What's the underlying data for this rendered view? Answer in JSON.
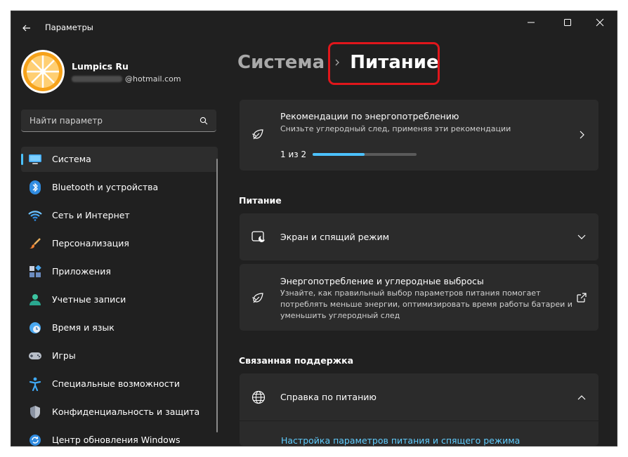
{
  "titlebar": {
    "app_title": "Параметры",
    "back_icon": "back-arrow-icon",
    "minimize_icon": "minimize-icon",
    "maximize_icon": "maximize-icon",
    "close_icon": "close-icon"
  },
  "profile": {
    "name": "Lumpics Ru",
    "email_visible_part": "@hotmail.com",
    "avatar_icon": "orange-slice-avatar"
  },
  "search": {
    "placeholder": "Найти параметр",
    "icon": "search-icon"
  },
  "sidebar": {
    "active_index": 0,
    "items": [
      {
        "label": "Система",
        "icon": "monitor-icon"
      },
      {
        "label": "Bluetooth и устройства",
        "icon": "bluetooth-icon"
      },
      {
        "label": "Сеть и Интернет",
        "icon": "wifi-icon"
      },
      {
        "label": "Персонализация",
        "icon": "brush-icon"
      },
      {
        "label": "Приложения",
        "icon": "apps-icon"
      },
      {
        "label": "Учетные записи",
        "icon": "person-icon"
      },
      {
        "label": "Время и язык",
        "icon": "clock-globe-icon"
      },
      {
        "label": "Игры",
        "icon": "gamepad-icon"
      },
      {
        "label": "Специальные возможности",
        "icon": "accessibility-icon"
      },
      {
        "label": "Конфиденциальность и защита",
        "icon": "shield-icon"
      },
      {
        "label": "Центр обновления Windows",
        "icon": "update-icon"
      }
    ]
  },
  "breadcrumb": {
    "parent": "Система",
    "current": "Питание"
  },
  "recommendations": {
    "title": "Рекомендации по энергопотреблению",
    "description": "Снизьте углеродный след, применяя эти рекомендации",
    "progress_text": "1 из 2",
    "progress_fraction": 0.5,
    "icon": "leaf-icon"
  },
  "power_section": {
    "title": "Питание",
    "screen_sleep": {
      "title": "Экран и спящий режим",
      "icon": "screen-sleep-icon"
    },
    "energy": {
      "title": "Энергопотребление и углеродные выбросы",
      "description": "Узнайте, как правильный выбор параметров питания помогает потреблять меньше энергии, оптимизировать время работы батареи и уменьшить углеродный след",
      "icon": "leaf-icon",
      "action_icon": "open-external-icon"
    }
  },
  "support_section": {
    "title": "Связанная поддержка",
    "help": {
      "title": "Справка по питанию",
      "icon": "globe-icon"
    },
    "link": "Настройка параметров питания и спящего режима"
  },
  "colors": {
    "accent": "#4cc2ff",
    "highlight_box": "#e0161b",
    "window_bg": "#202020",
    "card_bg": "#2b2b2b",
    "link": "#60cdff"
  }
}
